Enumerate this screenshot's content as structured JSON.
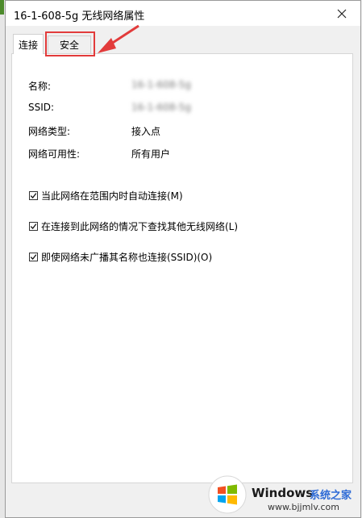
{
  "dialog": {
    "title": "16-1-608-5g 无线网络属性"
  },
  "tabs": [
    {
      "label": "连接"
    },
    {
      "label": "安全"
    }
  ],
  "info": {
    "name_label": "名称:",
    "name_value": "16-1-608-5g",
    "ssid_label": "SSID:",
    "ssid_value": "16-1-608-5g",
    "type_label": "网络类型:",
    "type_value": "接入点",
    "avail_label": "网络可用性:",
    "avail_value": "所有用户"
  },
  "checks": [
    {
      "label": "当此网络在范围内时自动连接(M)",
      "checked": true
    },
    {
      "label": "在连接到此网络的情况下查找其他无线网络(L)",
      "checked": true
    },
    {
      "label": "即使网络未广播其名称也连接(SSID)(O)",
      "checked": true
    }
  ],
  "watermark": {
    "brand": "Windows",
    "site_name": "系统之家",
    "url": "www.bjjmlv.com"
  },
  "colors": {
    "highlight": "#e23b3b",
    "accent": "#2e6bd6"
  }
}
